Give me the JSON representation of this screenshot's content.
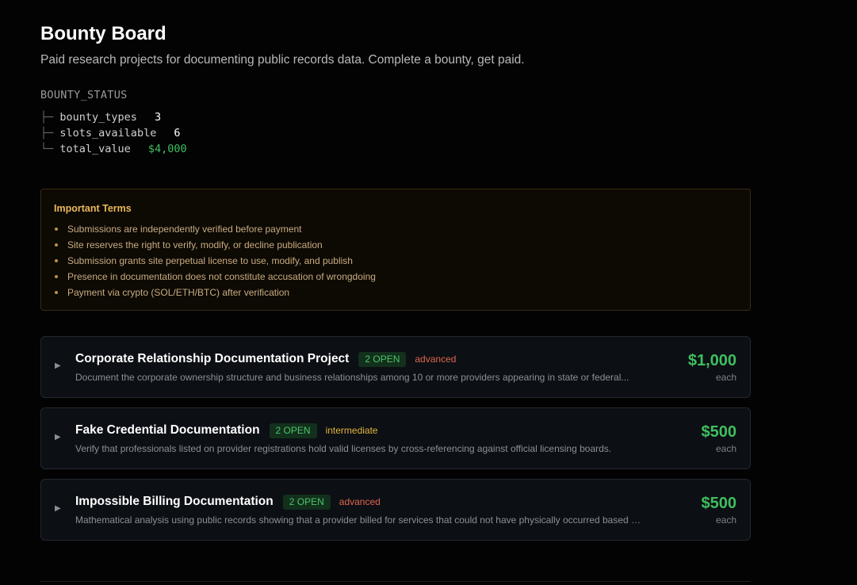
{
  "header": {
    "title": "Bounty Board",
    "subtitle": "Paid research projects for documenting public records data. Complete a bounty, get paid."
  },
  "status": {
    "heading": "BOUNTY_STATUS",
    "rows": [
      {
        "branch": "├─",
        "key": "bounty_types",
        "value": "3"
      },
      {
        "branch": "├─",
        "key": "slots_available",
        "value": "6"
      },
      {
        "branch": "└─",
        "key": "total_value",
        "value": "$4,000"
      }
    ]
  },
  "terms": {
    "title": "Important Terms",
    "items": [
      "Submissions are independently verified before payment",
      "Site reserves the right to verify, modify, or decline publication",
      "Submission grants site perpetual license to use, modify, and publish",
      "Presence in documentation does not constitute accusation of wrongdoing",
      "Payment via crypto (SOL/ETH/BTC) after verification"
    ]
  },
  "bounties": [
    {
      "title": "Corporate Relationship Documentation Project",
      "open": "2 OPEN",
      "level": "advanced",
      "description": "Document the corporate ownership structure and business relationships among 10 or more providers appearing in state or federal...",
      "price": "$1,000",
      "unit": "each"
    },
    {
      "title": "Fake Credential Documentation",
      "open": "2 OPEN",
      "level": "intermediate",
      "description": "Verify that professionals listed on provider registrations hold valid licenses by cross-referencing against official licensing boards.",
      "price": "$500",
      "unit": "each"
    },
    {
      "title": "Impossible Billing Documentation",
      "open": "2 OPEN",
      "level": "advanced",
      "description": "Mathematical analysis using public records showing that a provider billed for services that could not have physically occurred based on...",
      "price": "$500",
      "unit": "each"
    }
  ],
  "colors": {
    "accent_green": "#3fbf5f",
    "advanced": "#e0654c",
    "intermediate": "#e2b43c",
    "terms_title": "#e8b85a"
  },
  "icons": {
    "expand": "caret-right-icon"
  }
}
